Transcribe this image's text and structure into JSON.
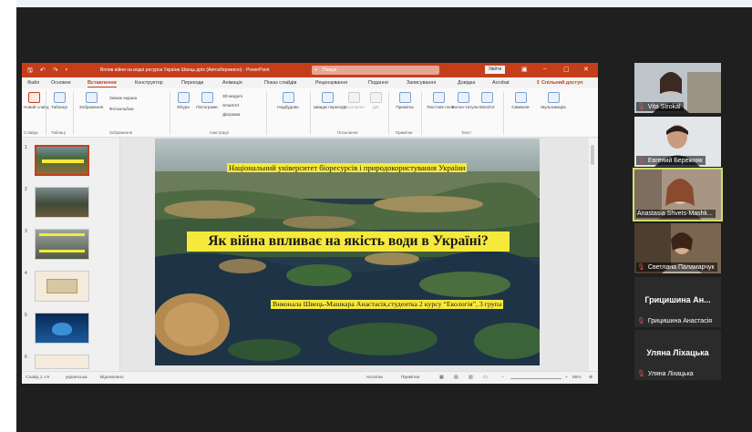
{
  "app": {
    "document_title": "Вплив війни на водні ресурси України Швець.pptx (Автозбережено) - PowerPoint",
    "search_placeholder": "Пошук",
    "signin_label": "Увійти"
  },
  "ribbon_tabs": [
    "Файл",
    "Основне",
    "Вставлення",
    "Конструктор",
    "Переходи",
    "Анімація",
    "Показ слайдів",
    "Рецензування",
    "Подання",
    "Записування",
    "Довідка",
    "Acrobat"
  ],
  "active_tab": "Вставлення",
  "share_label": "Спільний доступ",
  "ribbon": {
    "new_slide": "Новий слайд",
    "table": "Таблиця",
    "images": "Зображення",
    "screenshot": "Знімок екрана",
    "photo_album": "Фотоальбом",
    "shapes": "Фігури",
    "icons": "Піктограми",
    "models3d": "3D-моделі",
    "smartart": "SmartArt",
    "chart": "Діаграма",
    "addins": "Надбудови",
    "zoom": "Швидкі переходи",
    "link": "Посилання",
    "action": "Дія",
    "comment": "Примітка",
    "textbox": "Текстове поле",
    "header_footer": "Колон-титули",
    "wordart": "WordArt",
    "symbols": "Символи",
    "media": "Мультимедіа",
    "groups": {
      "slides": "Слайди",
      "tables": "Таблиці",
      "images": "Зображення",
      "illustrations": "Ілюстрації",
      "links": "Посилання",
      "comments": "Примітки",
      "text": "Текст"
    }
  },
  "slides": {
    "numbers": [
      "1",
      "2",
      "3",
      "4",
      "5",
      "6"
    ],
    "selected": 1
  },
  "slide": {
    "university": "Національний університет біоресурсів і природокористування України",
    "title": "Як війна впливає на якість води в Україні?",
    "author": "Виконала Швець-Машкара Анастасія,студентка 2 курсу “Екологія”, 3 група"
  },
  "status": {
    "slide_counter": "Слайд 1 з 9",
    "language": "українська",
    "accessibility": "Відновлено",
    "notes": "Нотатки",
    "comments": "Примітки",
    "zoom": "65%"
  },
  "participants": [
    {
      "name": "Vita Strokal",
      "muted": true
    },
    {
      "name": "Евгений Бережняк",
      "muted": true
    },
    {
      "name": "Anastasia Shvets-Mashk...",
      "muted": false
    },
    {
      "name": "Светлана Паламарчук",
      "muted": true
    },
    {
      "tile_name": "Грицишина Ан...",
      "name": "Грицишина Анастасія",
      "muted": true
    },
    {
      "tile_name": "Уляна Ліхацька",
      "name": "Уляна Ліхацька",
      "muted": true
    }
  ],
  "colors": {
    "ppt_accent": "#c43e1c",
    "highlight": "#f7e93b",
    "speaker_border": "#d0e06a"
  }
}
